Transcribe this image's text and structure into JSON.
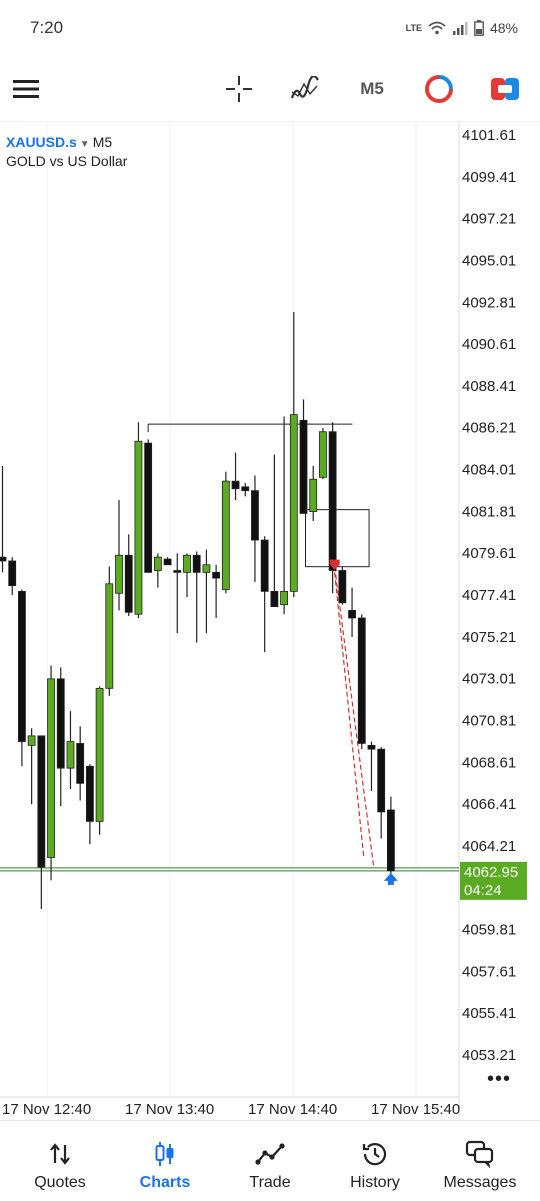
{
  "status_bar": {
    "time": "7:20",
    "battery": "48%",
    "network": "LTE"
  },
  "toolbar": {
    "timeframe": "M5",
    "icons": [
      "menu-icon",
      "crosshair-icon",
      "indicators-icon",
      "one-click-trading-icon",
      "trade-icon"
    ]
  },
  "symbol": {
    "name": "XAUUSD.s",
    "timeframe": "M5",
    "description": "GOLD vs US Dollar"
  },
  "chart_data": {
    "type": "candlestick",
    "symbol": "XAUUSD.s",
    "timeframe": "M5",
    "y_ticks": [
      "4101.61",
      "4099.41",
      "4097.21",
      "4095.01",
      "4092.81",
      "4090.61",
      "4088.41",
      "4086.21",
      "4084.01",
      "4081.81",
      "4079.61",
      "4077.41",
      "4075.21",
      "4073.01",
      "4070.81",
      "4068.61",
      "4066.41",
      "4064.21",
      "4059.81",
      "4057.61",
      "4055.41",
      "4053.21"
    ],
    "ylim": [
      4052.0,
      4102.9
    ],
    "x_labels": [
      "17 Nov 12:40",
      "17 Nov 13:40",
      "17 Nov 14:40",
      "17 Nov 15:40"
    ],
    "current_price": "4062.95",
    "countdown": "04:24",
    "colors": {
      "bull": "#5aab21",
      "bear": "#111111",
      "price_line": "#2e7d32",
      "price_tag": "#5aab21",
      "trade_marker": "#d32f2f",
      "arrow": "#1a73e8"
    },
    "candles": [
      {
        "o": 4079.4,
        "h": 4084.2,
        "l": 4078.6,
        "c": 4079.2
      },
      {
        "o": 4079.2,
        "h": 4079.4,
        "l": 4077.4,
        "c": 4077.9
      },
      {
        "o": 4077.6,
        "h": 4077.7,
        "l": 4068.4,
        "c": 4069.7
      },
      {
        "o": 4069.5,
        "h": 4070.4,
        "l": 4066.4,
        "c": 4070.0
      },
      {
        "o": 4070.0,
        "h": 4070.0,
        "l": 4060.9,
        "c": 4063.1
      },
      {
        "o": 4063.6,
        "h": 4073.7,
        "l": 4062.4,
        "c": 4073.0
      },
      {
        "o": 4073.0,
        "h": 4073.6,
        "l": 4066.3,
        "c": 4068.3
      },
      {
        "o": 4068.3,
        "h": 4071.3,
        "l": 4067.2,
        "c": 4069.7
      },
      {
        "o": 4069.6,
        "h": 4070.5,
        "l": 4066.6,
        "c": 4067.5
      },
      {
        "o": 4068.4,
        "h": 4068.5,
        "l": 4064.3,
        "c": 4065.5
      },
      {
        "o": 4065.5,
        "h": 4072.6,
        "l": 4064.8,
        "c": 4072.5
      },
      {
        "o": 4072.5,
        "h": 4078.9,
        "l": 4072.1,
        "c": 4078.0
      },
      {
        "o": 4077.5,
        "h": 4082.4,
        "l": 4076.6,
        "c": 4079.5
      },
      {
        "o": 4079.5,
        "h": 4080.6,
        "l": 4076.3,
        "c": 4076.5
      },
      {
        "o": 4076.4,
        "h": 4086.5,
        "l": 4076.2,
        "c": 4085.5
      },
      {
        "o": 4085.4,
        "h": 4085.6,
        "l": 4078.6,
        "c": 4078.6
      },
      {
        "o": 4078.7,
        "h": 4079.6,
        "l": 4077.8,
        "c": 4079.4
      },
      {
        "o": 4079.3,
        "h": 4079.4,
        "l": 4079.0,
        "c": 4079.0
      },
      {
        "o": 4078.7,
        "h": 4079.6,
        "l": 4075.4,
        "c": 4078.6
      },
      {
        "o": 4078.6,
        "h": 4079.6,
        "l": 4077.3,
        "c": 4079.5
      },
      {
        "o": 4079.5,
        "h": 4079.7,
        "l": 4074.9,
        "c": 4078.6
      },
      {
        "o": 4078.6,
        "h": 4079.8,
        "l": 4075.4,
        "c": 4079.0
      },
      {
        "o": 4078.6,
        "h": 4079.0,
        "l": 4076.2,
        "c": 4078.3
      },
      {
        "o": 4077.7,
        "h": 4083.9,
        "l": 4077.5,
        "c": 4083.4
      },
      {
        "o": 4083.4,
        "h": 4084.9,
        "l": 4082.4,
        "c": 4083.0
      },
      {
        "o": 4083.1,
        "h": 4083.3,
        "l": 4082.6,
        "c": 4082.9
      },
      {
        "o": 4082.9,
        "h": 4083.7,
        "l": 4078.1,
        "c": 4080.3
      },
      {
        "o": 4080.3,
        "h": 4080.5,
        "l": 4074.4,
        "c": 4077.6
      },
      {
        "o": 4077.6,
        "h": 4084.8,
        "l": 4076.8,
        "c": 4076.8
      },
      {
        "o": 4076.9,
        "h": 4086.8,
        "l": 4076.4,
        "c": 4077.6
      },
      {
        "o": 4077.6,
        "h": 4092.3,
        "l": 4077.3,
        "c": 4086.9
      },
      {
        "o": 4086.6,
        "h": 4087.7,
        "l": 4081.7,
        "c": 4081.7
      },
      {
        "o": 4081.8,
        "h": 4084.2,
        "l": 4081.3,
        "c": 4083.5
      },
      {
        "o": 4083.6,
        "h": 4086.2,
        "l": 4083.5,
        "c": 4086.0
      },
      {
        "o": 4086.0,
        "h": 4086.5,
        "l": 4077.5,
        "c": 4078.7
      },
      {
        "o": 4078.7,
        "h": 4078.9,
        "l": 4076.9,
        "c": 4077.0
      },
      {
        "o": 4076.6,
        "h": 4077.8,
        "l": 4075.2,
        "c": 4076.2
      },
      {
        "o": 4076.2,
        "h": 4076.4,
        "l": 4069.3,
        "c": 4069.6
      },
      {
        "o": 4069.5,
        "h": 4069.7,
        "l": 4067.1,
        "c": 4069.3
      },
      {
        "o": 4069.3,
        "h": 4069.4,
        "l": 4064.6,
        "c": 4066.0
      },
      {
        "o": 4066.1,
        "h": 4066.8,
        "l": 4062.6,
        "c": 4062.9
      }
    ],
    "lines": [
      {
        "kind": "horizontal",
        "from_candle": 15,
        "to_candle": 35,
        "y": 4086.4
      },
      {
        "kind": "rectangle",
        "from_candle": 31,
        "to_candle": 36,
        "y_top": 4081.9,
        "y_bottom": 4078.9
      },
      {
        "kind": "trade_link",
        "from_candle": 34,
        "y_from": 4078.9,
        "to_candle": 38,
        "y_to": 4063.2
      },
      {
        "kind": "trade_link",
        "from_candle": 34,
        "y_from": 4078.6,
        "to_candle": 37,
        "y_to": 4063.6
      }
    ]
  },
  "bottom_nav": [
    {
      "label": "Quotes",
      "icon": "quotes-icon",
      "active": false
    },
    {
      "label": "Charts",
      "icon": "charts-icon",
      "active": true
    },
    {
      "label": "Trade",
      "icon": "trade-nav-icon",
      "active": false
    },
    {
      "label": "History",
      "icon": "history-icon",
      "active": false
    },
    {
      "label": "Messages",
      "icon": "messages-icon",
      "active": false
    }
  ]
}
